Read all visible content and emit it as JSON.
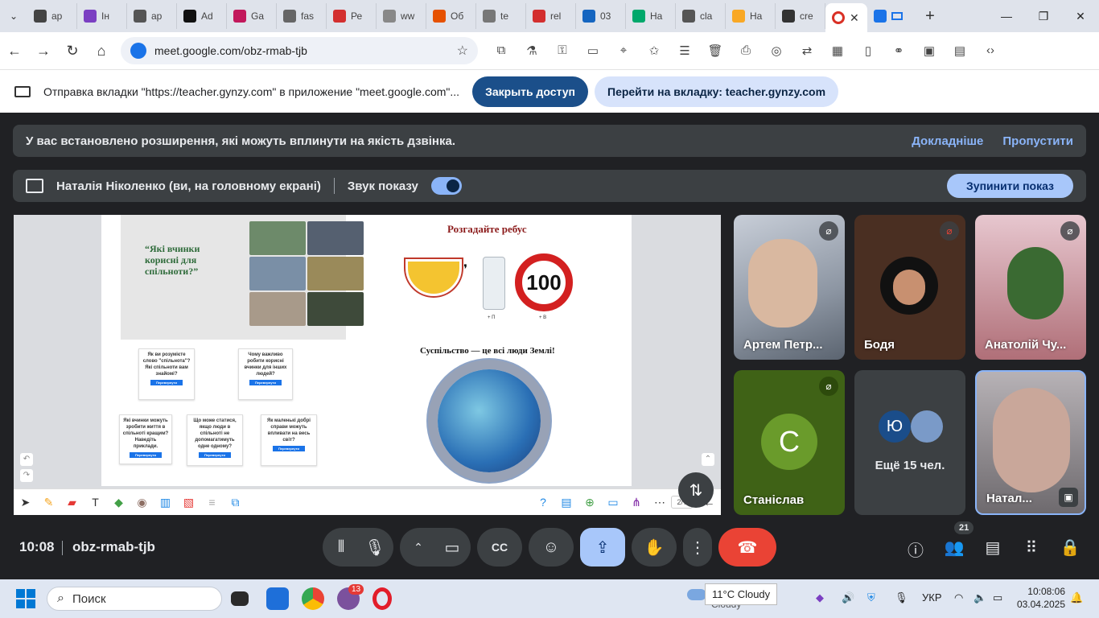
{
  "browser": {
    "tabs": [
      {
        "label": "ap",
        "color": "#444"
      },
      {
        "label": "Ін",
        "color": "#7b3fc2"
      },
      {
        "label": "ap",
        "color": "#555"
      },
      {
        "label": "Ad",
        "color": "#111"
      },
      {
        "label": "Ga",
        "color": "#c2185b"
      },
      {
        "label": "fas",
        "color": "#666"
      },
      {
        "label": "Ре",
        "color": "#d32f2f"
      },
      {
        "label": "ww",
        "color": "#888"
      },
      {
        "label": "Об",
        "color": "#e65100"
      },
      {
        "label": "te",
        "color": "#777"
      },
      {
        "label": "rel",
        "color": "#d32f2f"
      },
      {
        "label": "03",
        "color": "#1565c0"
      },
      {
        "label": "На",
        "color": "#00a86b"
      },
      {
        "label": "cla",
        "color": "#555"
      },
      {
        "label": "На",
        "color": "#f9a825"
      },
      {
        "label": "cre",
        "color": "#333"
      }
    ],
    "active_tab_color": "#d93025",
    "url": "meet.google.com/obz-rmab-tjb"
  },
  "share_bar": {
    "message": "Отправка вкладки \"https://teacher.gynzy.com\" в приложение \"meet.google.com\"...",
    "stop_access": "Закрыть доступ",
    "goto_tab": "Перейти на вкладку: teacher.gynzy.com"
  },
  "meet": {
    "extension_warning": {
      "text": "У вас встановлено розширення, які можуть вплинути на якість дзвінка.",
      "details": "Докладніше",
      "skip": "Пропустити"
    },
    "presentation_bar": {
      "presenter": "Наталія Ніколенко (ви, на головному екрані)",
      "sound_label": "Звук показу",
      "stop_button": "Зупинити показ"
    },
    "slide": {
      "question_title": "“Які вчинки корисні для спільноти?”",
      "cards": [
        "Як ви розумієте слово \"спільнота\"? Які спільноти вам знайомі?",
        "Чому важливо робити корисні вчинки для інших людей?",
        "Які вчинки можуть зробити життя в спільноті кращим? Наведіть приклади.",
        "Що може статися, якщо люди в спільноті не допомагатимуть одне одному?",
        "Як маленькі добрі справи можуть впливати на весь світ?"
      ],
      "card_button": "Перевернути",
      "rebus_title": "Розгадайте ребус",
      "rebus_number": "100",
      "rebus_plus_p": "+ П",
      "rebus_plus_v": "+ В",
      "society_title": "Суспільство — це всі люди Землі!",
      "page": "2/7"
    },
    "participants": [
      {
        "name": "Артем Петр...",
        "muted": true
      },
      {
        "name": "Бодя",
        "muted": true
      },
      {
        "name": "Анатолій Чу...",
        "muted": true
      },
      {
        "name": "Станіслав",
        "initial": "С",
        "muted": true
      },
      {
        "name": "Ещё 15 чел.",
        "initial": "Ю"
      },
      {
        "name": "Натал..."
      }
    ],
    "controls": {
      "time": "10:08",
      "code": "obz-rmab-tjb",
      "participant_count": "21"
    }
  },
  "taskbar": {
    "search_placeholder": "Поиск",
    "chat_badge": "13",
    "weather": "11°C Cloudy",
    "weather_sub": "Cloudy",
    "language": "УКР",
    "time": "10:08:06",
    "date": "03.04.2025"
  }
}
